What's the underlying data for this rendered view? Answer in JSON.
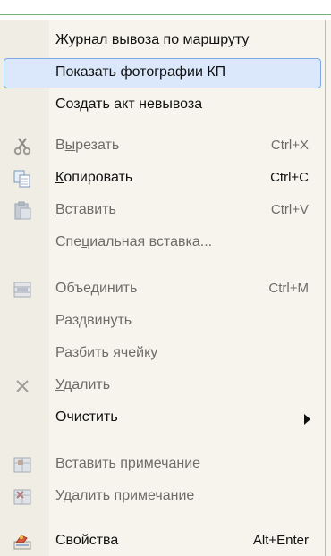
{
  "menu": {
    "items": [
      {
        "label": "Журнал вывоза по маршруту",
        "shortcut": "",
        "enabled": true,
        "highlighted": false,
        "icon": ""
      },
      {
        "label": "Показать фотографии КП",
        "shortcut": "",
        "enabled": true,
        "highlighted": true,
        "icon": ""
      },
      {
        "label": "Создать акт невывоза",
        "shortcut": "",
        "enabled": true,
        "highlighted": false,
        "icon": ""
      },
      {
        "label_before": "В",
        "label_mnemonic": "ы",
        "label_after": "резать",
        "shortcut": "Ctrl+X",
        "enabled": false,
        "icon": "scissors-icon"
      },
      {
        "label_before": "",
        "label_mnemonic": "К",
        "label_after": "опировать",
        "shortcut": "Ctrl+C",
        "enabled": true,
        "icon": "copy-icon"
      },
      {
        "label_before": "",
        "label_mnemonic": "В",
        "label_after": "ставить",
        "shortcut": "Ctrl+V",
        "enabled": false,
        "icon": "paste-icon"
      },
      {
        "label_before": "Спе",
        "label_mnemonic": "ц",
        "label_after": "иальная вставка...",
        "shortcut": "",
        "enabled": false,
        "icon": ""
      },
      {
        "label": "Объединить",
        "shortcut": "Ctrl+M",
        "enabled": false,
        "icon": "merge-cells-icon"
      },
      {
        "label": "Раздвинуть",
        "shortcut": "",
        "enabled": false,
        "icon": ""
      },
      {
        "label": "Разбить ячейку",
        "shortcut": "",
        "enabled": false,
        "icon": ""
      },
      {
        "label_before": "",
        "label_mnemonic": "У",
        "label_after": "далить",
        "shortcut": "",
        "enabled": false,
        "icon": "delete-x-icon"
      },
      {
        "label": "Очистить",
        "shortcut": "",
        "enabled": true,
        "icon": "",
        "submenu": true
      },
      {
        "label": "Вставить примечание",
        "shortcut": "",
        "enabled": false,
        "icon": "insert-note-icon"
      },
      {
        "label": "Удалить примечание",
        "shortcut": "",
        "enabled": false,
        "icon": "delete-note-icon"
      },
      {
        "label": "Свойства",
        "shortcut": "Alt+Enter",
        "enabled": true,
        "icon": "properties-icon"
      }
    ]
  },
  "colors": {
    "menu_bg": "#f6f4ed",
    "highlight_bg": "#dbe8fb",
    "highlight_border": "#7ea9e3",
    "disabled_text": "#6e6c66"
  }
}
